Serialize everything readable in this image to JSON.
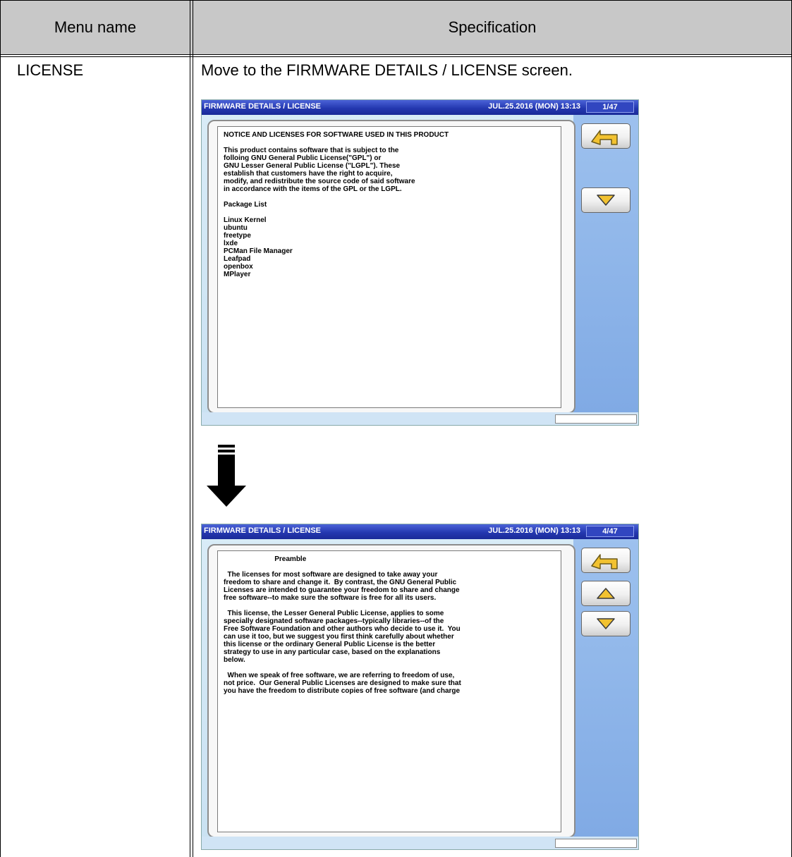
{
  "table": {
    "headers": [
      "Menu name",
      "Specification"
    ],
    "row": {
      "menu_name": "LICENSE",
      "description": "Move to the FIRMWARE DETAILS / LICENSE screen."
    }
  },
  "screen1": {
    "title": "FIRMWARE DETAILS / LICENSE",
    "datetime": "JUL.25.2016 (MON)  13:13",
    "page": "1/47",
    "lines": [
      "NOTICE AND LICENSES FOR SOFTWARE USED IN THIS PRODUCT",
      "",
      "This product contains software that is subject to the",
      "folloing GNU General Public License(\"GPL\") or",
      "GNU Lesser General Public License (\"LGPL\"). These",
      "establish that customers have the right to acquire,",
      "modify, and redistribute the source code of said software",
      "in accordance with the items of the GPL or the LGPL.",
      "",
      "Package List",
      "",
      "Linux Kernel",
      "ubuntu",
      "freetype",
      "lxde",
      "PCMan File Manager",
      "Leafpad",
      "openbox",
      "MPlayer"
    ]
  },
  "screen2": {
    "title": "FIRMWARE DETAILS / LICENSE",
    "datetime": "JUL.25.2016 (MON)  13:13",
    "page": "4/47",
    "lines": [
      "                          Preamble",
      "",
      "  The licenses for most software are designed to take away your",
      "freedom to share and change it.  By contrast, the GNU General Public",
      "Licenses are intended to guarantee your freedom to share and change",
      "free software--to make sure the software is free for all its users.",
      "",
      "  This license, the Lesser General Public License, applies to some",
      "specially designated software packages--typically libraries--of the",
      "Free Software Foundation and other authors who decide to use it.  You",
      "can use it too, but we suggest you first think carefully about whether",
      "this license or the ordinary General Public License is the better",
      "strategy to use in any particular case, based on the explanations",
      "below.",
      "",
      "  When we speak of free software, we are referring to freedom of use,",
      "not price.  Our General Public Licenses are designed to make sure that",
      "you have the freedom to distribute copies of free software (and charge"
    ]
  },
  "icons": {
    "return": "return-arrow-icon",
    "up": "triangle-up-icon",
    "down": "triangle-down-icon",
    "transition": "down-arrow-icon"
  },
  "colors": {
    "title_bar": "#2438b0",
    "header_band": "#c8c8c8",
    "triangle_fill": "#f2c230",
    "return_arrow": "#f2c230"
  }
}
